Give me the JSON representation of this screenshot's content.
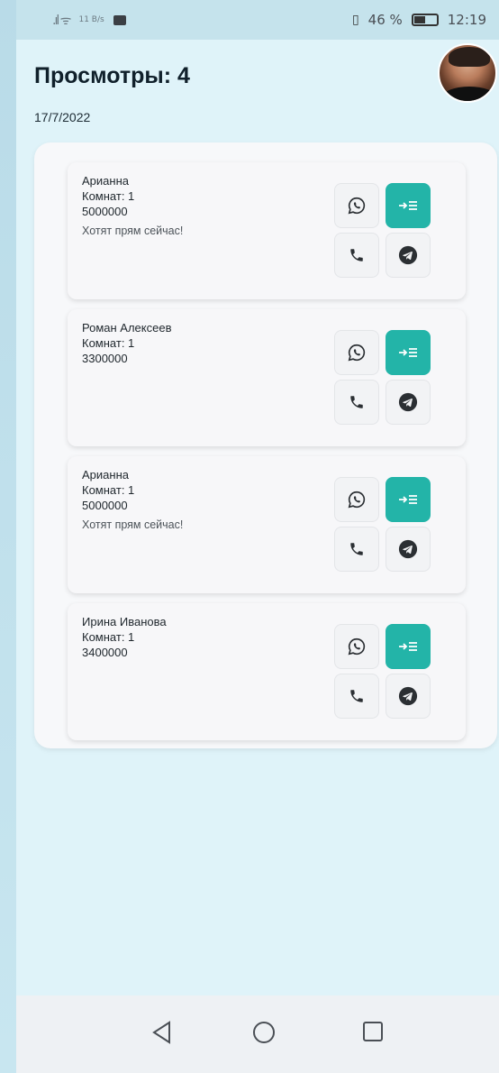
{
  "status_bar": {
    "network": "11\nB/s",
    "battery": "46 %",
    "time": "12:19"
  },
  "header": {
    "title": "Просмотры: 4",
    "date": "17/7/2022"
  },
  "cards": [
    {
      "name": "Арианна",
      "rooms": "Комнат: 1",
      "price": "5000000",
      "note": "Хотят прям сейчас!"
    },
    {
      "name": "Роман Алексеев",
      "rooms": "Комнат: 1",
      "price": "3300000",
      "note": ""
    },
    {
      "name": "Арианна",
      "rooms": "Комнат: 1",
      "price": "5000000",
      "note": "Хотят прям сейчас!"
    },
    {
      "name": "Ирина Иванова",
      "rooms": "Комнат: 1",
      "price": "3400000",
      "note": ""
    }
  ],
  "card_actions": {
    "whatsapp": "whatsapp-icon",
    "open": "arrow-list-icon",
    "call": "phone-icon",
    "telegram": "telegram-icon"
  },
  "colors": {
    "accent": "#23b4a8",
    "background": "#dff3f9"
  }
}
